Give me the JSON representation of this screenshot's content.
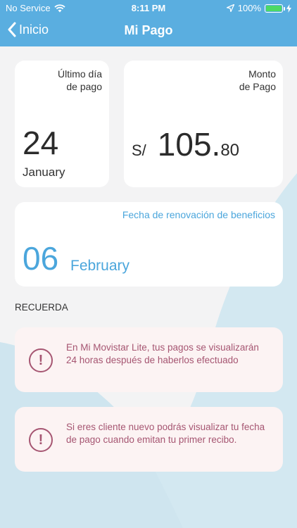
{
  "status_bar": {
    "carrier": "No Service",
    "time": "8:11 PM",
    "battery": "100%",
    "battery_level": 1.0
  },
  "header": {
    "back_label": "Inicio",
    "title": "Mi Pago"
  },
  "payment_date": {
    "label_line1": "Último día",
    "label_line2": "de pago",
    "day": "24",
    "month": "January"
  },
  "payment_amount": {
    "label_line1": "Monto",
    "label_line2": "de Pago",
    "currency": "S/",
    "integer": "105.",
    "decimal": "80"
  },
  "renewal": {
    "label": "Fecha de renovación de beneficios",
    "day": "06",
    "month": "February"
  },
  "section_title": "RECUERDA",
  "notices": [
    {
      "icon": "exclamation-icon",
      "text": "En Mi Movistar Lite, tus pagos se visualizarán 24 horas después de haberlos efectuado"
    },
    {
      "icon": "exclamation-icon",
      "text": "Si eres cliente nuevo podrás visualizar tu fecha de pago cuando emitan tu primer recibo."
    }
  ],
  "colors": {
    "header": "#5aaee0",
    "accent": "#4ba6dc",
    "notice_text": "#a65672",
    "notice_bg": "#fcf3f3",
    "background": "#f3f3f4",
    "wave": "#cfe5ef"
  }
}
